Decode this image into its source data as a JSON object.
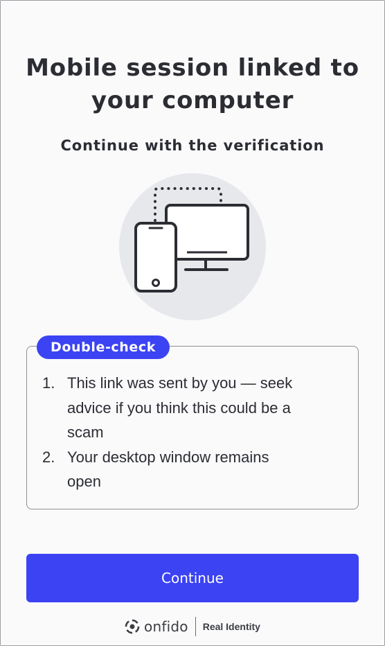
{
  "header": {
    "title_line1": "Mobile session linked to",
    "title_line2": "your computer",
    "subtitle": "Continue with the verification"
  },
  "illustration": {
    "icon": "phone-linked-to-desktop-icon"
  },
  "double_check": {
    "badge": "Double-check",
    "items": [
      {
        "number": "1.",
        "line1": "This link was sent by you — seek",
        "line2": "advice if you think this could be a",
        "line3": "scam"
      },
      {
        "number": "2.",
        "line1": "Your desktop window remains",
        "line2": "open"
      }
    ]
  },
  "actions": {
    "continue_label": "Continue"
  },
  "footer": {
    "brand": "onfido",
    "tagline": "Real Identity"
  },
  "colors": {
    "accent": "#3b43f2",
    "background": "#fafafb",
    "text": "#2b2d33"
  }
}
